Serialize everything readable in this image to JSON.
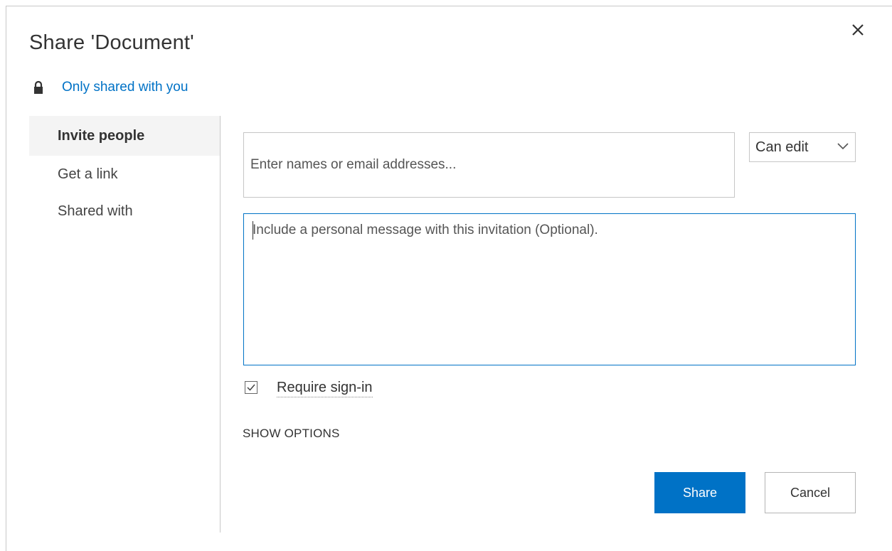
{
  "dialog": {
    "title": "Share 'Document'",
    "close_icon": "close-icon"
  },
  "sharing_status": {
    "icon": "lock-icon",
    "text": "Only shared with you"
  },
  "nav": {
    "items": [
      {
        "label": "Invite people",
        "active": true
      },
      {
        "label": "Get a link",
        "active": false
      },
      {
        "label": "Shared with",
        "active": false
      }
    ]
  },
  "invite": {
    "names_placeholder": "Enter names or email addresses...",
    "names_value": "",
    "permission": {
      "selected": "Can edit",
      "icon": "chevron-down-icon"
    },
    "message_placeholder": "Include a personal message with this invitation (Optional).",
    "message_value": "",
    "require_signin": {
      "label": "Require sign-in",
      "checked": true
    },
    "show_options": "SHOW OPTIONS"
  },
  "buttons": {
    "share": "Share",
    "cancel": "Cancel"
  },
  "colors": {
    "accent": "#0072c6",
    "text": "#333333",
    "border": "#c6c6c6",
    "nav_active_bg": "#f4f4f4"
  }
}
